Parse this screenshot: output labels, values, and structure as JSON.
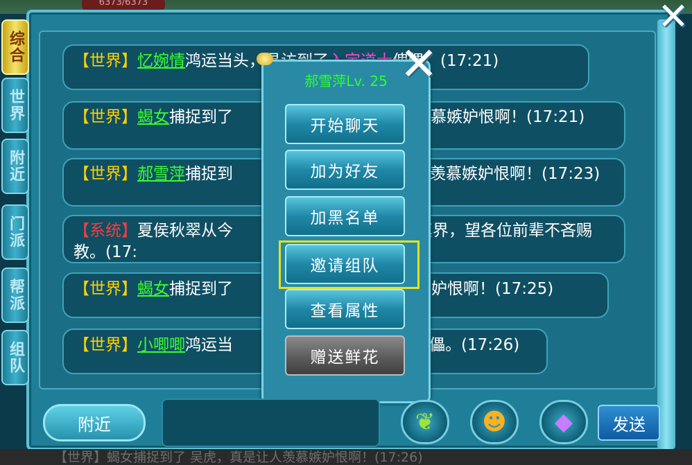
{
  "top_bar": {
    "hp_text": "6373/6373"
  },
  "tabs": [
    {
      "label": "综合",
      "active": true
    },
    {
      "label": "世界",
      "active": false
    },
    {
      "label": "附近",
      "active": false
    },
    {
      "label": "门派",
      "active": false
    },
    {
      "label": "帮派",
      "active": false
    },
    {
      "label": "组队",
      "active": false
    }
  ],
  "messages": [
    {
      "channel": "世界",
      "name": "忆婉情",
      "text_a": "鸿运当头，寻访到了",
      "highlight": "入定道士",
      "text_b": "傀儡。(17:21)"
    },
    {
      "channel": "世界",
      "name": "蝎女",
      "text_a": "捕捉到了",
      "text_b": "真是让人羡慕嫉妒恨啊！(17:21)"
    },
    {
      "channel": "世界",
      "name": "郝雪萍",
      "text_a": "捕捉到",
      "text_b": "真是让人羡慕嫉妒恨啊！(17:23)"
    },
    {
      "channel": "系统",
      "text_a": "夏侯秋翠从今",
      "text_b": "正式踏入修真界，望各位前辈不吝赐教。(17:"
    },
    {
      "channel": "世界",
      "name": "蝎女",
      "text_a": "捕捉到了",
      "text_b": "慕嫉妒恨啊！(17:25)"
    },
    {
      "channel": "世界",
      "name": "小唧唧",
      "text_a": "鸿运当",
      "text_b": "傀儡。(17:26)"
    }
  ],
  "popup": {
    "title": "郝雪萍Lv. 25",
    "buttons": [
      "开始聊天",
      "加为好友",
      "加黑名单",
      "邀请组队",
      "查看属性",
      "赠送鲜花"
    ],
    "highlighted": "邀请组队"
  },
  "bottom": {
    "nearby_label": "附近",
    "send_label": "发送",
    "ticker": "【世界】蝎女捕捉到了 吴虎，真是让人羡慕嫉妒恨啊！(17:26)"
  },
  "icons": [
    "close-icon",
    "popup-close-icon",
    "leaf-emoji-icon",
    "cat-face-icon",
    "shield-emblem-icon"
  ]
}
